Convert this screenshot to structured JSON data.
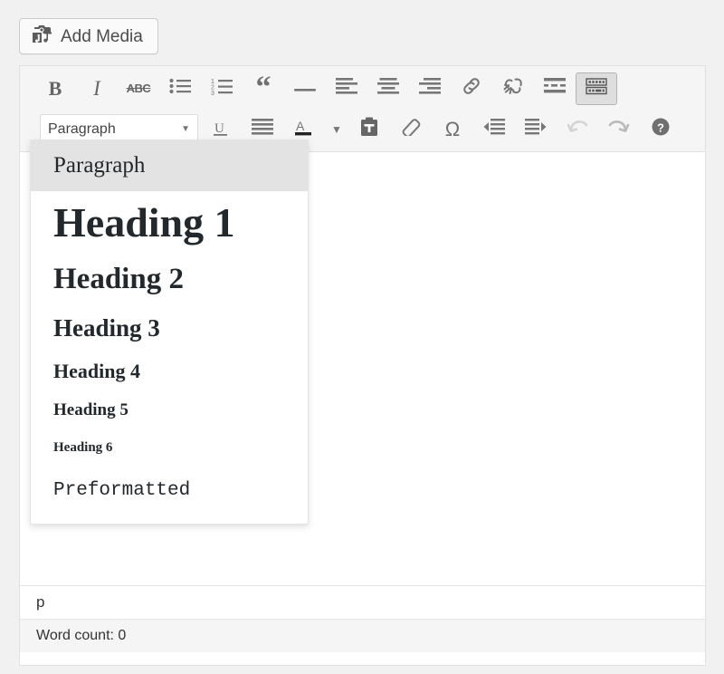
{
  "media": {
    "button_label": "Add Media",
    "icon": "media-camera-note-icon"
  },
  "toolbar": {
    "row1": [
      {
        "name": "bold-button",
        "label": "B",
        "icon": "bold-icon",
        "state": "normal"
      },
      {
        "name": "italic-button",
        "label": "I",
        "icon": "italic-icon",
        "state": "normal"
      },
      {
        "name": "strikethrough-button",
        "label": "ABC",
        "icon": "strikethrough-icon",
        "state": "normal"
      },
      {
        "name": "bulleted-list-button",
        "label": "",
        "icon": "bulleted-list-icon",
        "state": "normal"
      },
      {
        "name": "numbered-list-button",
        "label": "",
        "icon": "numbered-list-icon",
        "state": "normal"
      },
      {
        "name": "blockquote-button",
        "label": "“",
        "icon": "blockquote-icon",
        "state": "normal"
      },
      {
        "name": "horizontal-rule-button",
        "label": "",
        "icon": "horizontal-rule-icon",
        "state": "normal"
      },
      {
        "name": "align-left-button",
        "label": "",
        "icon": "align-left-icon",
        "state": "normal"
      },
      {
        "name": "align-center-button",
        "label": "",
        "icon": "align-center-icon",
        "state": "normal"
      },
      {
        "name": "align-right-button",
        "label": "",
        "icon": "align-right-icon",
        "state": "normal"
      },
      {
        "name": "insert-link-button",
        "label": "",
        "icon": "link-icon",
        "state": "normal"
      },
      {
        "name": "remove-link-button",
        "label": "",
        "icon": "unlink-icon",
        "state": "normal"
      },
      {
        "name": "insert-more-button",
        "label": "",
        "icon": "insert-more-icon",
        "state": "normal"
      },
      {
        "name": "toggle-toolbar-button",
        "label": "",
        "icon": "toolbar-toggle-icon",
        "state": "active"
      }
    ],
    "row2": [
      {
        "name": "format-select",
        "label": "Paragraph",
        "icon": "format-select",
        "state": "open"
      },
      {
        "name": "underline-button",
        "label": "U",
        "icon": "underline-icon",
        "state": "normal"
      },
      {
        "name": "justify-button",
        "label": "",
        "icon": "align-justify-icon",
        "state": "normal"
      },
      {
        "name": "text-color-button",
        "label": "A",
        "icon": "text-color-icon",
        "state": "normal"
      },
      {
        "name": "text-color-dropdown",
        "label": "",
        "icon": "chevron-down-icon",
        "state": "normal"
      },
      {
        "name": "paste-as-text-button",
        "label": "",
        "icon": "paste-as-text-icon",
        "state": "normal"
      },
      {
        "name": "clear-formatting-button",
        "label": "",
        "icon": "eraser-icon",
        "state": "normal"
      },
      {
        "name": "special-character-button",
        "label": "Ω",
        "icon": "omega-icon",
        "state": "normal"
      },
      {
        "name": "decrease-indent-button",
        "label": "",
        "icon": "outdent-icon",
        "state": "normal"
      },
      {
        "name": "increase-indent-button",
        "label": "",
        "icon": "indent-icon",
        "state": "normal"
      },
      {
        "name": "undo-button",
        "label": "",
        "icon": "undo-icon",
        "state": "disabled"
      },
      {
        "name": "redo-button",
        "label": "",
        "icon": "redo-icon",
        "state": "normal"
      },
      {
        "name": "keyboard-shortcuts-button",
        "label": "?",
        "icon": "help-icon",
        "state": "normal"
      }
    ]
  },
  "format_menu": {
    "selected": "Paragraph",
    "items": [
      {
        "label": "Paragraph",
        "style": "fi-paragraph",
        "selected": true
      },
      {
        "label": "Heading 1",
        "style": "fi-h1",
        "selected": false
      },
      {
        "label": "Heading 2",
        "style": "fi-h2",
        "selected": false
      },
      {
        "label": "Heading 3",
        "style": "fi-h3",
        "selected": false
      },
      {
        "label": "Heading 4",
        "style": "fi-h4",
        "selected": false
      },
      {
        "label": "Heading 5",
        "style": "fi-h5",
        "selected": false
      },
      {
        "label": "Heading 6",
        "style": "fi-h6",
        "selected": false
      },
      {
        "label": "Preformatted",
        "style": "fi-pre",
        "selected": false
      }
    ]
  },
  "editor": {
    "body_text": ""
  },
  "statusbar": {
    "element_path": "p",
    "word_count": "Word count: 0"
  },
  "colors": {
    "page_bg": "#f1f1f1",
    "toolbar_bg": "#f5f5f5",
    "editor_bg": "#ffffff",
    "border": "#e1e1e1",
    "icon": "#777777",
    "active_bg": "#dedede",
    "menu_selected_bg": "#e3e3e3",
    "text": "#23282d"
  }
}
